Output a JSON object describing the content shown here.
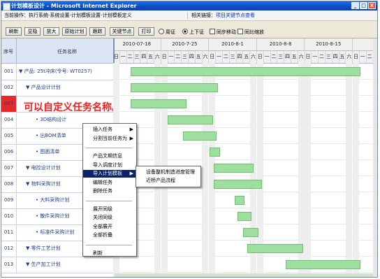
{
  "window": {
    "title": "计划模板设计 - Microsoft Internet Explorer",
    "minimize_glyph": "_",
    "maximize_glyph": "□",
    "close_glyph": "X"
  },
  "breadcrumb": {
    "path": "当前操作：执行系统-系统设置-计划模板设置-计划模板定义",
    "related_label": "相关链接：",
    "related_link": "项目关键节点查看"
  },
  "toolbar": {
    "buttons": [
      "刷新",
      "显隐",
      "放大",
      "原始计划",
      "跟踪",
      "关键节点",
      "打印"
    ],
    "options": [
      {
        "label": "周证",
        "type": "radio",
        "checked": false
      },
      {
        "label": "上下证",
        "type": "radio",
        "checked": true
      },
      {
        "label": "同步移动",
        "type": "checkbox",
        "checked": false
      },
      {
        "label": "同比缩放",
        "type": "checkbox",
        "checked": false
      }
    ]
  },
  "task_list": {
    "col_no": "序号",
    "col_name": "任务名称",
    "rows": [
      {
        "no": "001",
        "name": "▼ 产品: 25t冲床(令号: WT0257)"
      },
      {
        "no": "002",
        "name": "▼ 产品设计计划"
      },
      {
        "no": "003",
        "name": ""
      },
      {
        "no": "004",
        "name": "• 3D结构设计"
      },
      {
        "no": "005",
        "name": "• 出BOM清单"
      },
      {
        "no": "006",
        "name": "• 图面清单"
      },
      {
        "no": "007",
        "name": "▼ 电控设计计划"
      },
      {
        "no": "008",
        "name": "▼ 物料采购计划"
      },
      {
        "no": "009",
        "name": "• 大料采购计划"
      },
      {
        "no": "010",
        "name": "• 散件采购计划"
      },
      {
        "no": "011",
        "name": "• 标准件采购计划"
      },
      {
        "no": "012",
        "name": "▼ 零件工艺计划"
      },
      {
        "no": "013",
        "name": "▼ 生产加工计划"
      }
    ]
  },
  "annotation": "可以自定义任务名称。",
  "timeline": {
    "weeks": [
      "2010-07-18",
      "2010-7-25",
      "2010-8-1",
      "2010-8-8",
      "2010-8-15"
    ],
    "weekdays": [
      "日",
      "一",
      "二",
      "三",
      "四",
      "五",
      "六"
    ]
  },
  "context_menu": {
    "items": [
      {
        "label": "插入任务",
        "submenu": true
      },
      {
        "label": "分割当前任务为",
        "submenu": true
      },
      {
        "separator": true
      },
      {
        "label": "产品文期信息"
      },
      {
        "label": "导入调度计划"
      },
      {
        "label": "导入计划模板",
        "submenu": true,
        "highlighted": true
      },
      {
        "label": "编辑任务"
      },
      {
        "label": "删除任务"
      },
      {
        "separator": true
      },
      {
        "label": "展开同级"
      },
      {
        "label": "关闭同级"
      },
      {
        "label": "全部展开"
      },
      {
        "label": "全部折叠"
      },
      {
        "separator": true
      },
      {
        "label": "刷新"
      }
    ],
    "submenu_items": [
      "设备整机制造进度管理",
      "近桥产品流程"
    ]
  },
  "colors": {
    "bar_fill": "#9ede9e",
    "title_blue": "#0a4fc9",
    "annotation_red": "#ff1a1a",
    "menu_highlight": "#0a246a"
  }
}
